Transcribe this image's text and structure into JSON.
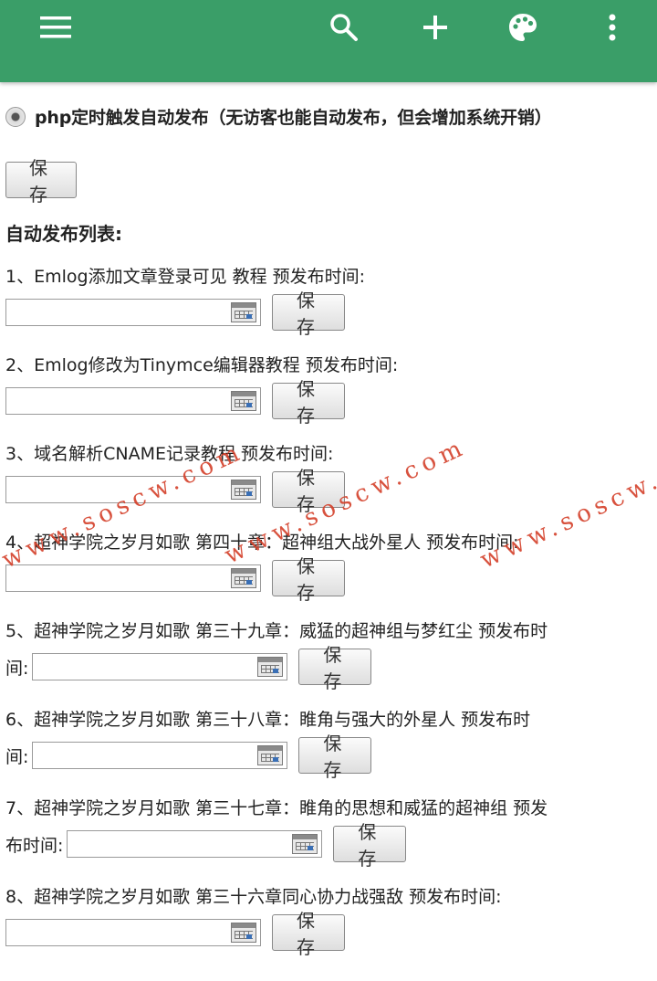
{
  "appbar": {
    "icons": [
      "menu-icon",
      "search-icon",
      "plus-icon",
      "palette-icon",
      "more-vert-icon"
    ],
    "color": "#3a9e68"
  },
  "option": {
    "label": "php定时触发自动发布（无访客也能自动发布，但会增加系统开销）",
    "selected": true
  },
  "save_label": "保存",
  "list_title": "自动发布列表:",
  "items": [
    {
      "text": "1、Emlog添加文章登录可见 教程  预发布时间:",
      "tail": ""
    },
    {
      "text": "2、Emlog修改为Tinymce编辑器教程  预发布时间:",
      "tail": ""
    },
    {
      "text": "3、域名解析CNAME记录教程  预发布时间:",
      "tail": ""
    },
    {
      "text": "4、超神学院之岁月如歌 第四十章：超神组大战外星人  预发布时间:",
      "tail": ""
    },
    {
      "text": "5、超神学院之岁月如歌 第三十九章：威猛的超神组与梦红尘  预发布时",
      "tail": "间:"
    },
    {
      "text": "6、超神学院之岁月如歌 第三十八章：睢角与强大的外星人  预发布时",
      "tail": "间:"
    },
    {
      "text": "7、超神学院之岁月如歌 第三十七章：睢角的思想和威猛的超神组  预发",
      "tail": "布时间:"
    },
    {
      "text": "8、超神学院之岁月如歌 第三十六章同心协力战强敌  预发布时间:",
      "tail": ""
    }
  ],
  "watermark": "www.soscw.com"
}
